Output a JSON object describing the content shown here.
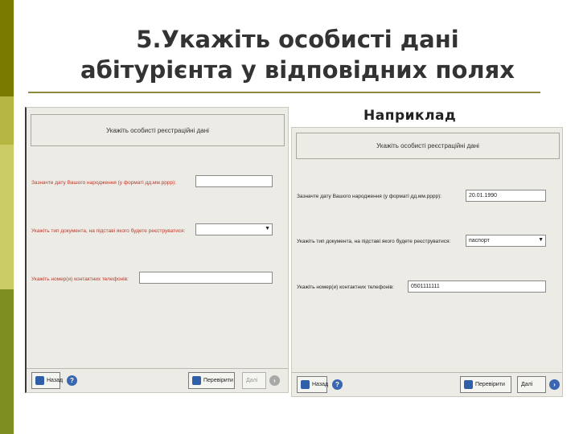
{
  "slide": {
    "title_line1": "5.Укажіть особисті дані",
    "title_line2": "абітурієнта у відповідних полях",
    "example_label": "Наприклад"
  },
  "form_left": {
    "heading": "Укажіть особисті реєстраційні дані",
    "birth_label": "Зазначте дату Вашого народження (у форматі дд.мм.рррр):",
    "birth_value": "",
    "doc_label": "Укажіть тип документа, на підставі якого будете реєструватися:",
    "doc_value": "",
    "phone_label": "Укажіть номер(и) контактних телефонів:",
    "phone_value": "",
    "back_button": "Назад",
    "clear_button": "Перевірити",
    "next_button": "Далі"
  },
  "form_right": {
    "heading": "Укажіть особисті реєстраційні дані",
    "birth_label": "Зазначте дату Вашого народження (у форматі дд.мм.рррр):",
    "birth_value": "20.01.1990",
    "doc_label": "Укажіть тип документа, на підставі якого будете реєструватися:",
    "doc_value": "паспорт",
    "phone_label": "Укажіть номер(и) контактних телефонів:",
    "phone_value": "0501111111",
    "back_button": "Назад",
    "clear_button": "Перевірити",
    "next_button": "Далі"
  },
  "colors": {
    "accent_dark": "#7a7a00",
    "accent_light": "#cccc66",
    "required_label": "#c0392b"
  }
}
